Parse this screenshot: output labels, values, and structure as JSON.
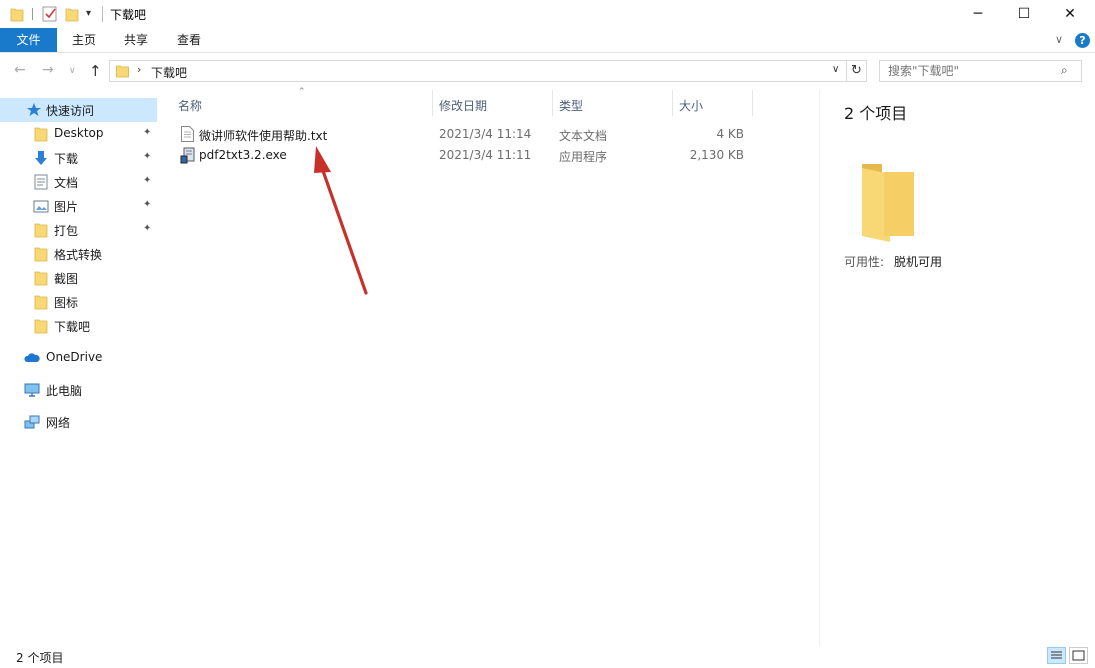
{
  "window": {
    "title": "下载吧",
    "minimize": "─",
    "maximize": "☐",
    "close": "✕"
  },
  "ribbon": {
    "tabs": [
      "文件",
      "主页",
      "共享",
      "查看"
    ],
    "expand": "∨",
    "help": "?"
  },
  "nav": {
    "back": "←",
    "forward": "→",
    "recent": "∨",
    "up": "↑",
    "path_separator": "›",
    "path": "下载吧",
    "path_dropdown": "∨",
    "refresh": "↻",
    "search_placeholder": "搜索\"下载吧\"",
    "search_icon": "⌕"
  },
  "sidebar": {
    "quick_access": "快速访问",
    "items": [
      {
        "label": "Desktop",
        "pinned": true,
        "icon": "folder-icon"
      },
      {
        "label": "下载",
        "pinned": true,
        "icon": "download-icon"
      },
      {
        "label": "文档",
        "pinned": true,
        "icon": "document-icon"
      },
      {
        "label": "图片",
        "pinned": true,
        "icon": "picture-icon"
      },
      {
        "label": "打包",
        "pinned": true,
        "icon": "folder-icon"
      },
      {
        "label": "格式转换",
        "pinned": false,
        "icon": "folder-icon"
      },
      {
        "label": "截图",
        "pinned": false,
        "icon": "folder-icon"
      },
      {
        "label": "图标",
        "pinned": false,
        "icon": "folder-icon"
      },
      {
        "label": "下载吧",
        "pinned": false,
        "icon": "folder-icon"
      }
    ],
    "onedrive": "OneDrive",
    "this_pc": "此电脑",
    "network": "网络",
    "pin_glyph": "📌"
  },
  "columns": {
    "name": "名称",
    "date": "修改日期",
    "type": "类型",
    "size": "大小",
    "sort_glyph": "⌃"
  },
  "files": [
    {
      "name": "微讲师软件使用帮助.txt",
      "date": "2021/3/4 11:14",
      "type": "文本文档",
      "size": "4 KB",
      "icon": "text-file-icon"
    },
    {
      "name": "pdf2txt3.2.exe",
      "date": "2021/3/4 11:11",
      "type": "应用程序",
      "size": "2,130 KB",
      "icon": "exe-file-icon"
    }
  ],
  "preview": {
    "count": "2 个项目",
    "availability_label": "可用性:",
    "availability_value": "脱机可用"
  },
  "status": {
    "count": "2 个项目"
  },
  "colors": {
    "accent": "#1979ca",
    "selection": "#cce8ff",
    "folder": "#f8d775",
    "arrow": "#c8302a"
  }
}
